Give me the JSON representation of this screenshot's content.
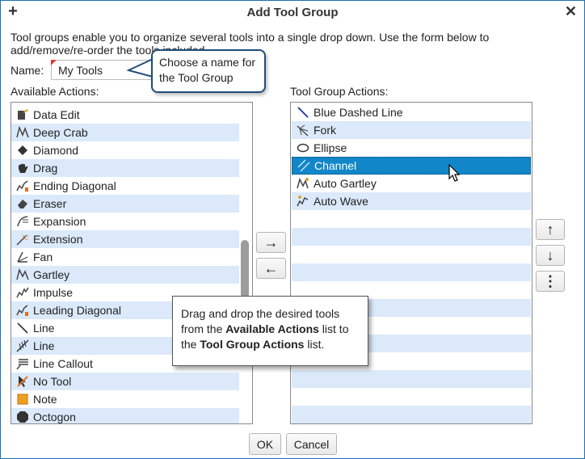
{
  "window": {
    "title": "Add Tool Group",
    "plus_icon": "+",
    "close_icon": "✕"
  },
  "description": "Tool groups enable you to organize several tools into a single drop down.  Use the form below to add/remove/re-order the tools included.",
  "name_field": {
    "label": "Name:",
    "value": "My Tools"
  },
  "callout": {
    "text": "Choose a name for the Tool Group"
  },
  "available": {
    "label": "Available Actions:",
    "items": [
      {
        "label": "Data Edit",
        "icon": "data-edit-icon"
      },
      {
        "label": "Deep Crab",
        "icon": "deep-crab-icon"
      },
      {
        "label": "Diamond",
        "icon": "diamond-icon"
      },
      {
        "label": "Drag",
        "icon": "drag-hand-icon"
      },
      {
        "label": "Ending Diagonal",
        "icon": "ending-diagonal-icon"
      },
      {
        "label": "Eraser",
        "icon": "eraser-icon"
      },
      {
        "label": "Expansion",
        "icon": "expansion-icon"
      },
      {
        "label": "Extension",
        "icon": "extension-icon"
      },
      {
        "label": "Fan",
        "icon": "fan-icon"
      },
      {
        "label": "Gartley",
        "icon": "gartley-icon"
      },
      {
        "label": "Impulse",
        "icon": "impulse-icon"
      },
      {
        "label": "Leading Diagonal",
        "icon": "leading-diagonal-icon"
      },
      {
        "label": "Line",
        "icon": "line-icon"
      },
      {
        "label": "Line",
        "icon": "line-hash-icon"
      },
      {
        "label": "Line Callout",
        "icon": "line-callout-icon"
      },
      {
        "label": "No Tool",
        "icon": "no-tool-icon"
      },
      {
        "label": "Note",
        "icon": "note-icon"
      },
      {
        "label": "Octogon",
        "icon": "octogon-icon"
      }
    ]
  },
  "group": {
    "label": "Tool Group Actions:",
    "items": [
      {
        "label": "Blue Dashed Line",
        "icon": "blue-dashed-line-icon"
      },
      {
        "label": "Fork",
        "icon": "fork-icon"
      },
      {
        "label": "Ellipse",
        "icon": "ellipse-icon"
      },
      {
        "label": "Channel",
        "icon": "channel-icon",
        "selected": true
      },
      {
        "label": "Auto Gartley",
        "icon": "auto-gartley-icon"
      },
      {
        "label": "Auto Wave",
        "icon": "auto-wave-icon"
      }
    ]
  },
  "transfer_buttons": {
    "add_icon": "→",
    "remove_icon": "←"
  },
  "order_buttons": {
    "up_icon": "↑",
    "down_icon": "↓",
    "more_icon": "⋮"
  },
  "tooltip": {
    "part1": "Drag and drop the desired tools from the ",
    "bold1": "Available Actions",
    "part2": " list to the ",
    "bold2": "Tool Group Actions",
    "part3": " list."
  },
  "footer": {
    "ok_label": "OK",
    "cancel_label": "Cancel"
  },
  "colors": {
    "accent": "#1186c8",
    "row_alt": "#dbe9fa",
    "callout_border": "#1f4e79",
    "window_border": "#1f6fb4"
  }
}
